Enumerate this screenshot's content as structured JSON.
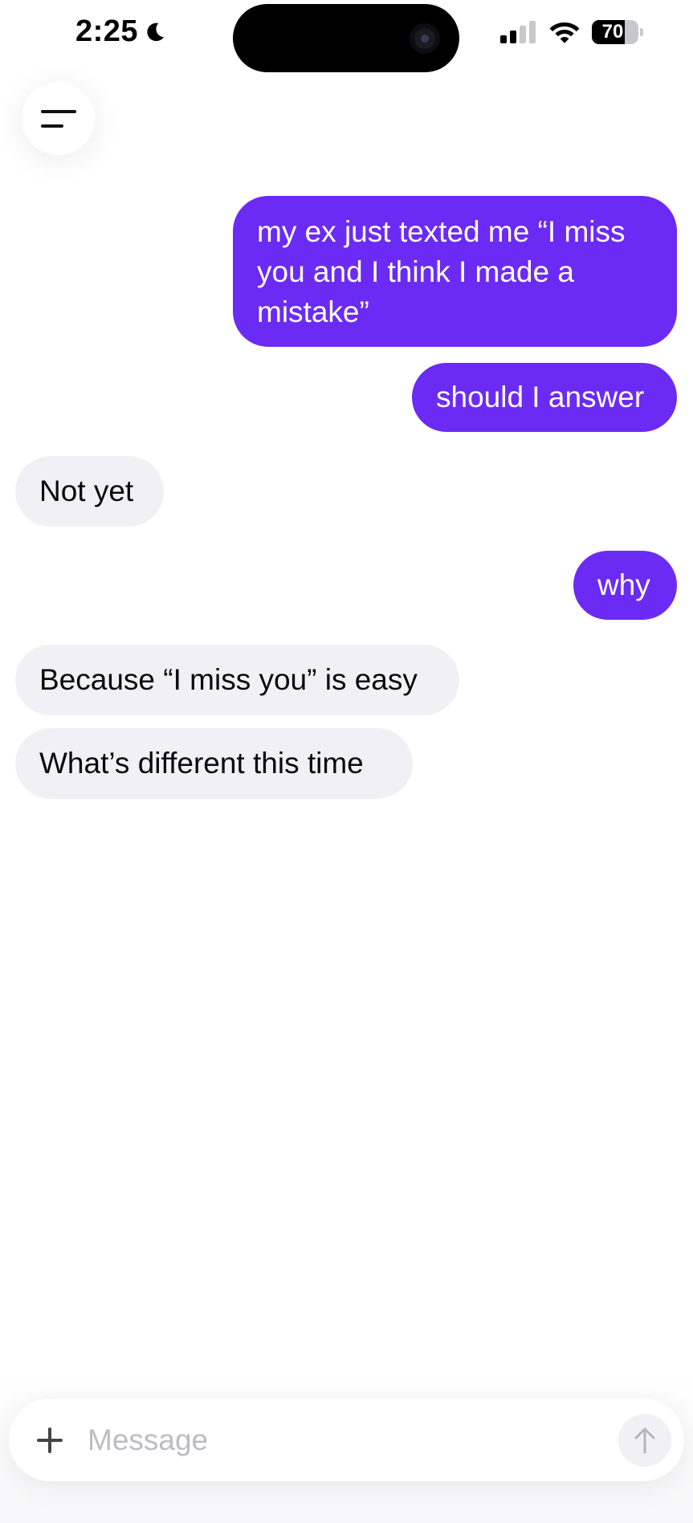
{
  "status_bar": {
    "time": "2:25",
    "battery_text": "70",
    "battery_level": 0.7,
    "icons": [
      "moon-icon",
      "signal-icon",
      "wifi-icon",
      "battery-icon"
    ]
  },
  "menu": {
    "icon": "menu-icon"
  },
  "messages": [
    {
      "role": "user",
      "text": "my ex just texted me “I miss you and I think I made a mistake”"
    },
    {
      "role": "user",
      "text": "should I answer"
    },
    {
      "role": "assistant",
      "text": "Not yet"
    },
    {
      "role": "user",
      "text": "why"
    },
    {
      "role": "assistant",
      "text": "Because “I miss you” is easy"
    },
    {
      "role": "assistant",
      "text": "What’s different this time"
    }
  ],
  "composer": {
    "placeholder": "Message",
    "value": "",
    "icons": [
      "plus-icon",
      "arrow-up-icon"
    ]
  },
  "colors": {
    "user_bubble": "#6b2bf5",
    "assistant_bubble": "#f1f1f5",
    "placeholder": "#bcbcc4"
  }
}
